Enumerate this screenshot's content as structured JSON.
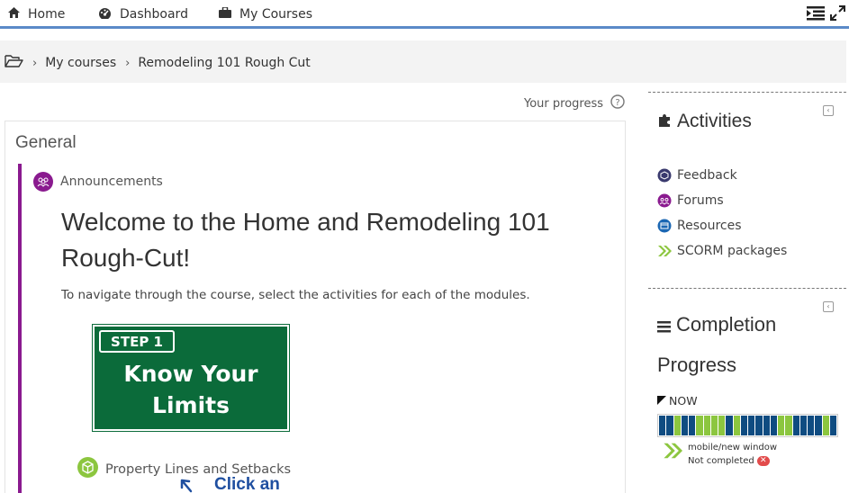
{
  "nav": {
    "home": "Home",
    "dashboard": "Dashboard",
    "my_courses": "My Courses"
  },
  "breadcrumb": {
    "items": [
      "My courses",
      "Remodeling 101 Rough Cut"
    ]
  },
  "progress": {
    "label": "Your progress"
  },
  "section": {
    "title": "General",
    "announcements": "Announcements",
    "welcome": "Welcome to the Home and Remodeling 101 Rough-Cut!",
    "instructions": "To navigate through the course, select the activities for each of the modules.",
    "sign": {
      "step": "STEP 1",
      "line1": "Know Your",
      "line2": "Limits"
    },
    "property": "Property Lines and Setbacks",
    "click_text": "Click an"
  },
  "activities": {
    "title": "Activities",
    "items": [
      {
        "label": "Feedback",
        "icon": "feedback-icon",
        "color": "#3a3a6e"
      },
      {
        "label": "Forums",
        "icon": "forums-icon",
        "color": "#8a1a8f"
      },
      {
        "label": "Resources",
        "icon": "resources-icon",
        "color": "#1b67b3"
      },
      {
        "label": "SCORM packages",
        "icon": "scorm-icon",
        "color": "#8cc63f"
      }
    ]
  },
  "completion": {
    "title_line1": "Completion",
    "title_line2": "Progress",
    "now": "NOW",
    "cells": [
      "b",
      "b",
      "g",
      "b",
      "b",
      "g",
      "g",
      "g",
      "g",
      "b",
      "g",
      "b",
      "b",
      "b",
      "b",
      "b",
      "g",
      "g",
      "b",
      "b",
      "b",
      "b",
      "g",
      "b"
    ],
    "colors": {
      "b": "#0f4c81",
      "g": "#8cc63f"
    },
    "item_name": "mobile/new window",
    "item_status": "Not completed"
  }
}
